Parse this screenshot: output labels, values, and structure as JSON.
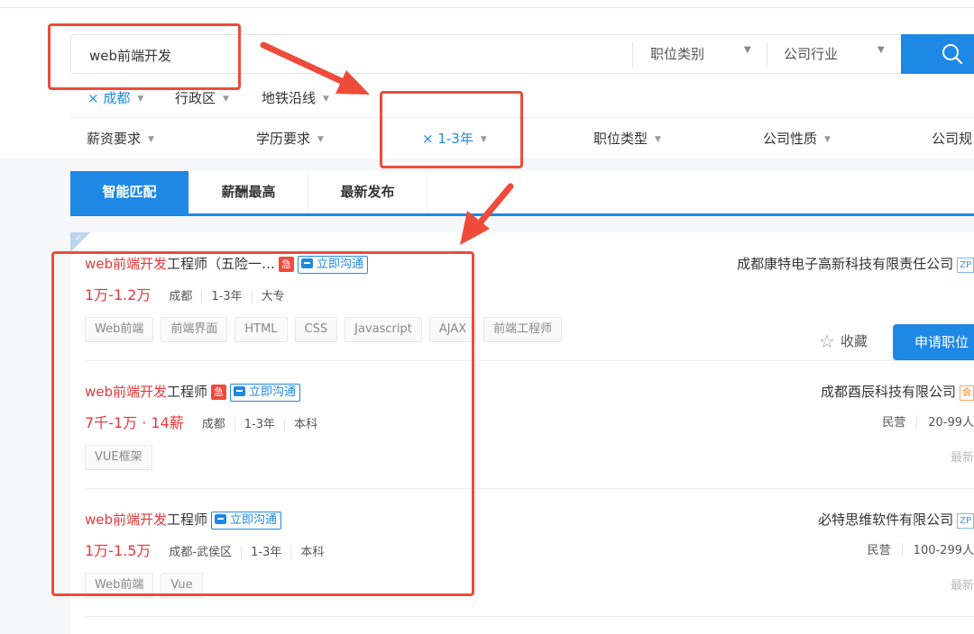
{
  "search": {
    "query": "web前端开发",
    "job_category": "职位类别",
    "industry": "公司行业"
  },
  "filters_row1": {
    "city": "× 成都",
    "district": "行政区",
    "metro": "地铁沿线"
  },
  "filters_row2": {
    "salary": "薪资要求",
    "education": "学历要求",
    "experience": "× 1-3年",
    "job_type": "职位类型",
    "company_type": "公司性质",
    "company_size": "公司规"
  },
  "tabs": [
    "智能匹配",
    "薪酬最高",
    "最新发布"
  ],
  "jobs": [
    {
      "title_hl": "web前端开发",
      "title_rest": "工程师（五险一…",
      "urgent": "急",
      "chat": "立即沟通",
      "salary": "1万-1.2万",
      "meta": [
        "成都",
        "1-3年",
        "大专"
      ],
      "tags": [
        "Web前端",
        "前端界面",
        "HTML",
        "CSS",
        "Javascript",
        "AJAX",
        "前端工程师"
      ],
      "company": "成都康特电子高新科技有限责任公司",
      "badge": "ZP",
      "fav": "收藏",
      "apply": "申请职位"
    },
    {
      "title_hl": "web前端开发",
      "title_rest": "工程师",
      "urgent": "急",
      "chat": "立即沟通",
      "salary": "7千-1万 · 14薪",
      "meta": [
        "成都",
        "1-3年",
        "本科"
      ],
      "tags": [
        "VUE框架"
      ],
      "company": "成都酉辰科技有限公司",
      "badge": "会",
      "company_type": "民营",
      "company_size": "20-99人",
      "latest": "最新"
    },
    {
      "title_hl": "web前端开发",
      "title_rest": "工程师",
      "chat": "立即沟通",
      "salary": "1万-1.5万",
      "meta": [
        "成都-武侯区",
        "1-3年",
        "本科"
      ],
      "tags": [
        "Web前端",
        "Vue"
      ],
      "company": "必特思维软件有限公司",
      "badge": "ZP",
      "company_type": "民营",
      "company_size": "100-299人",
      "latest": "最新"
    }
  ],
  "colors": {
    "accent": "#1e88e5",
    "highlight": "#e4393c",
    "annotation": "#ee4b3a"
  },
  "icons": [
    "search-icon",
    "star-icon",
    "chat-icon",
    "check-icon",
    "caret-down-icon",
    "arrow-annotation"
  ]
}
